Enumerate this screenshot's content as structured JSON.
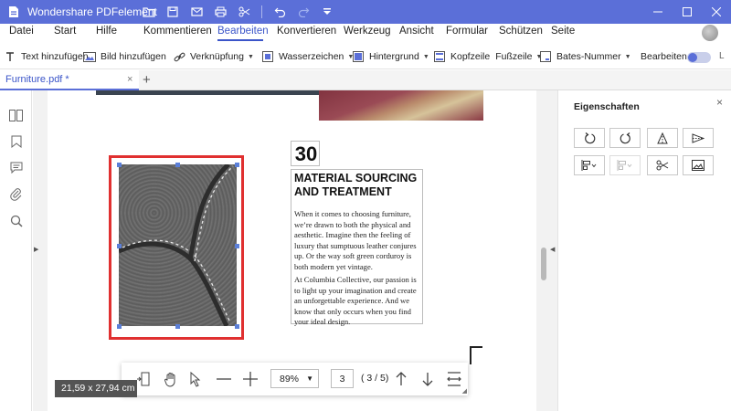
{
  "app": {
    "title": "Wondershare PDFelement",
    "brand_color": "#5b6fd8"
  },
  "titlebar_icons": [
    "folder-icon",
    "save-icon",
    "mail-icon",
    "print-icon",
    "scissors-icon",
    "undo-icon",
    "redo-icon",
    "quick-access-dropdown-icon"
  ],
  "menu": {
    "items": [
      "Datei",
      "Start",
      "Hilfe",
      "Kommentieren",
      "Bearbeiten",
      "Konvertieren",
      "Werkzeug",
      "Ansicht",
      "Formular",
      "Schützen",
      "Seite"
    ],
    "active": "Bearbeiten"
  },
  "toolbar": {
    "text_add": "Text hinzufügen",
    "image_add": "Bild hinzufügen",
    "link": "Verknüpfung",
    "watermark": "Wasserzeichen",
    "background": "Hintergrund",
    "header": "Kopfzeile",
    "footer": "Fußzeile",
    "bates": "Bates-Nummer",
    "edit": "Bearbeiten",
    "more": "L"
  },
  "tab": {
    "label": "Furniture.pdf *",
    "close": "×",
    "add": "+"
  },
  "document": {
    "number": "30",
    "heading": "MATERIAL SOURCING AND TREATMENT",
    "para1": "When it comes to choosing furniture, we’re drawn to both the physical and aesthetic. Imagine then the feeling of luxury that sumptuous leather conjures up. Or the way soft green corduroy is both modern yet vintage.",
    "para2": "At Columbia Collective, our passion is to light up your imagination and create an unforgettable experience. And we know that only occurs when you find your ideal design."
  },
  "bottom_bar": {
    "zoom": "89%",
    "page_input": "3",
    "page_count": "( 3 / 5)"
  },
  "dimensions": "21,59 x 27,94 cm",
  "properties": {
    "title": "Eigenschaften",
    "close": "×"
  }
}
